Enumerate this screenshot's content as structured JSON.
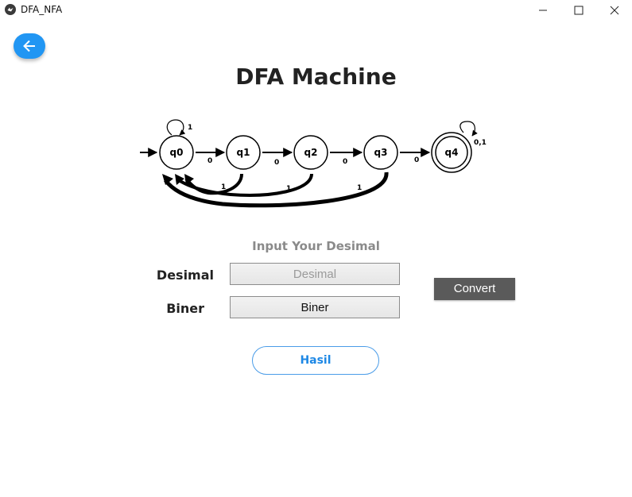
{
  "window": {
    "title": "DFA_NFA",
    "app_icon": "kivy-logo-icon",
    "controls": [
      "minimize-icon",
      "maximize-icon",
      "close-icon"
    ]
  },
  "back_button": {
    "icon": "arrow-left-icon",
    "color": "#2196f3"
  },
  "heading": "DFA Machine",
  "diagram": {
    "states": [
      "q0",
      "q1",
      "q2",
      "q3",
      "q4"
    ],
    "accepting_state": "q4",
    "labels": {
      "q0_self_loop": "1",
      "q4_self_loop": "0,1",
      "q0_q1": "0",
      "q1_q2": "0",
      "q2_q3": "0",
      "q3_q4": "0",
      "q1_back": "1",
      "q2_back": "1",
      "q3_back": "1"
    }
  },
  "subtitle": "Input Your Desimal",
  "desimal": {
    "label": "Desimal",
    "placeholder": "Desimal",
    "value": ""
  },
  "biner": {
    "label": "Biner",
    "value": "Biner"
  },
  "convert_label": "Convert",
  "hasil_label": "Hasil",
  "colors": {
    "accent": "#2196f3",
    "convert_bg": "#5a5a5a",
    "subtitle": "#8a8a8a"
  }
}
